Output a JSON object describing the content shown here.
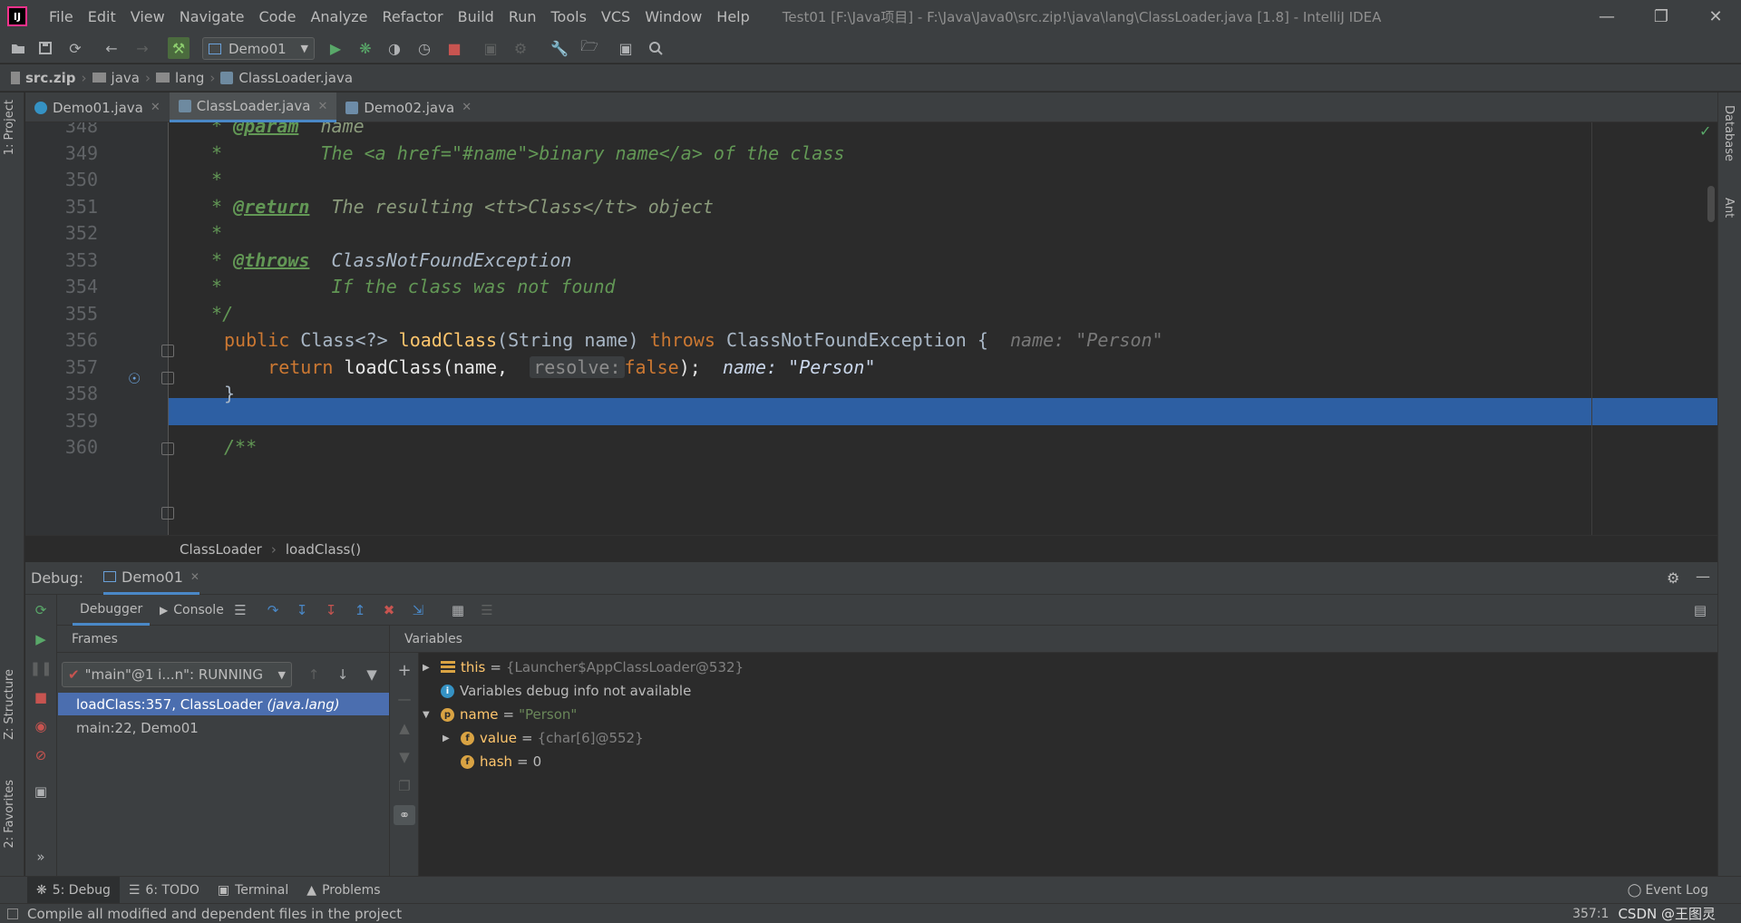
{
  "titlebar": {
    "menu": [
      "File",
      "Edit",
      "View",
      "Navigate",
      "Code",
      "Analyze",
      "Refactor",
      "Build",
      "Run",
      "Tools",
      "VCS",
      "Window",
      "Help"
    ],
    "window_title": "Test01 [F:\\Java项目] - F:\\Java\\Java0\\src.zip!\\java\\lang\\ClassLoader.java [1.8] - IntelliJ IDEA"
  },
  "toolbar": {
    "run_config": "Demo01"
  },
  "navbar": {
    "crumbs": [
      "src.zip",
      "java",
      "lang",
      "ClassLoader.java"
    ]
  },
  "left_strip": {
    "project": "1: Project",
    "structure": "Z: Structure",
    "favorites": "2: Favorites"
  },
  "right_strip": {
    "database": "Database",
    "ant": "Ant"
  },
  "tabs": [
    {
      "label": "Demo01.java"
    },
    {
      "label": "ClassLoader.java"
    },
    {
      "label": "Demo02.java"
    }
  ],
  "editor": {
    "lines": [
      {
        "num": "348",
        "text": " * @param  name"
      },
      {
        "num": "349",
        "text": " *         The <a href=\"#name\">binary name</a> of the class"
      },
      {
        "num": "350",
        "text": " *"
      },
      {
        "num": "351",
        "text": " * @return  The resulting <tt>Class</tt> object"
      },
      {
        "num": "352",
        "text": " *"
      },
      {
        "num": "353",
        "text": " * @throws  ClassNotFoundException"
      },
      {
        "num": "354",
        "text": " *          If the class was not found"
      },
      {
        "num": "355",
        "text": " */"
      },
      {
        "num": "356",
        "text": "public Class<?> loadClass(String name) throws ClassNotFoundException {"
      },
      {
        "num": "357",
        "text": "    return loadClass(name, resolve: false);"
      },
      {
        "num": "358",
        "text": "}"
      },
      {
        "num": "359",
        "text": ""
      },
      {
        "num": "360",
        "text": "/**"
      }
    ],
    "c348_tag": "@param",
    "c348_rest": "  name",
    "c349": "The <a href=\"#name\">binary name</a> of the class",
    "c351_tag": "@return",
    "c351_rest": "  The resulting <tt>Class</tt> object",
    "c353_tag": "@throws",
    "c353_rest": "  ClassNotFoundException",
    "c354": "If the class was not found",
    "c356_public": "public",
    "c356_class": "Class<?>",
    "c356_fn": "loadClass",
    "c356_args": "(String name)",
    "c356_throws": "throws",
    "c356_exc": "ClassNotFoundException {",
    "c356_hint": "name: \"Person\"",
    "c357_return": "return",
    "c357_call": "loadClass(name,",
    "c357_param_hint": "resolve:",
    "c357_false": "false",
    "c357_end": ");",
    "c357_hint": "name: \"Person\"",
    "c358": "}",
    "c360": "/**",
    "crumbs": [
      "ClassLoader",
      "loadClass()"
    ]
  },
  "debug": {
    "label": "Debug:",
    "session": "Demo01",
    "tab_debugger": "Debugger",
    "tab_console": "Console",
    "frames_title": "Frames",
    "variables_title": "Variables",
    "thread": "\"main\"@1 i...n\": RUNNING",
    "frames": [
      {
        "method": "loadClass:357, ClassLoader",
        "pkg": "(java.lang)"
      },
      {
        "method": "main:22, Demo01",
        "pkg": ""
      }
    ],
    "variables": {
      "this_name": "this",
      "this_val": "{Launcher$AppClassLoader@532}",
      "info": "Variables debug info not available",
      "name_name": "name",
      "name_val": "\"Person\"",
      "value_name": "value",
      "value_val": "{char[6]@552}",
      "hash_name": "hash",
      "hash_val": "0"
    }
  },
  "bottombar": {
    "debug": "5: Debug",
    "todo": "6: TODO",
    "terminal": "Terminal",
    "problems": "Problems",
    "event_log": "Event Log"
  },
  "statusbar": {
    "message": "Compile all modified and dependent files in the project",
    "position": "357:1",
    "watermark": "CSDN @王图灵"
  }
}
